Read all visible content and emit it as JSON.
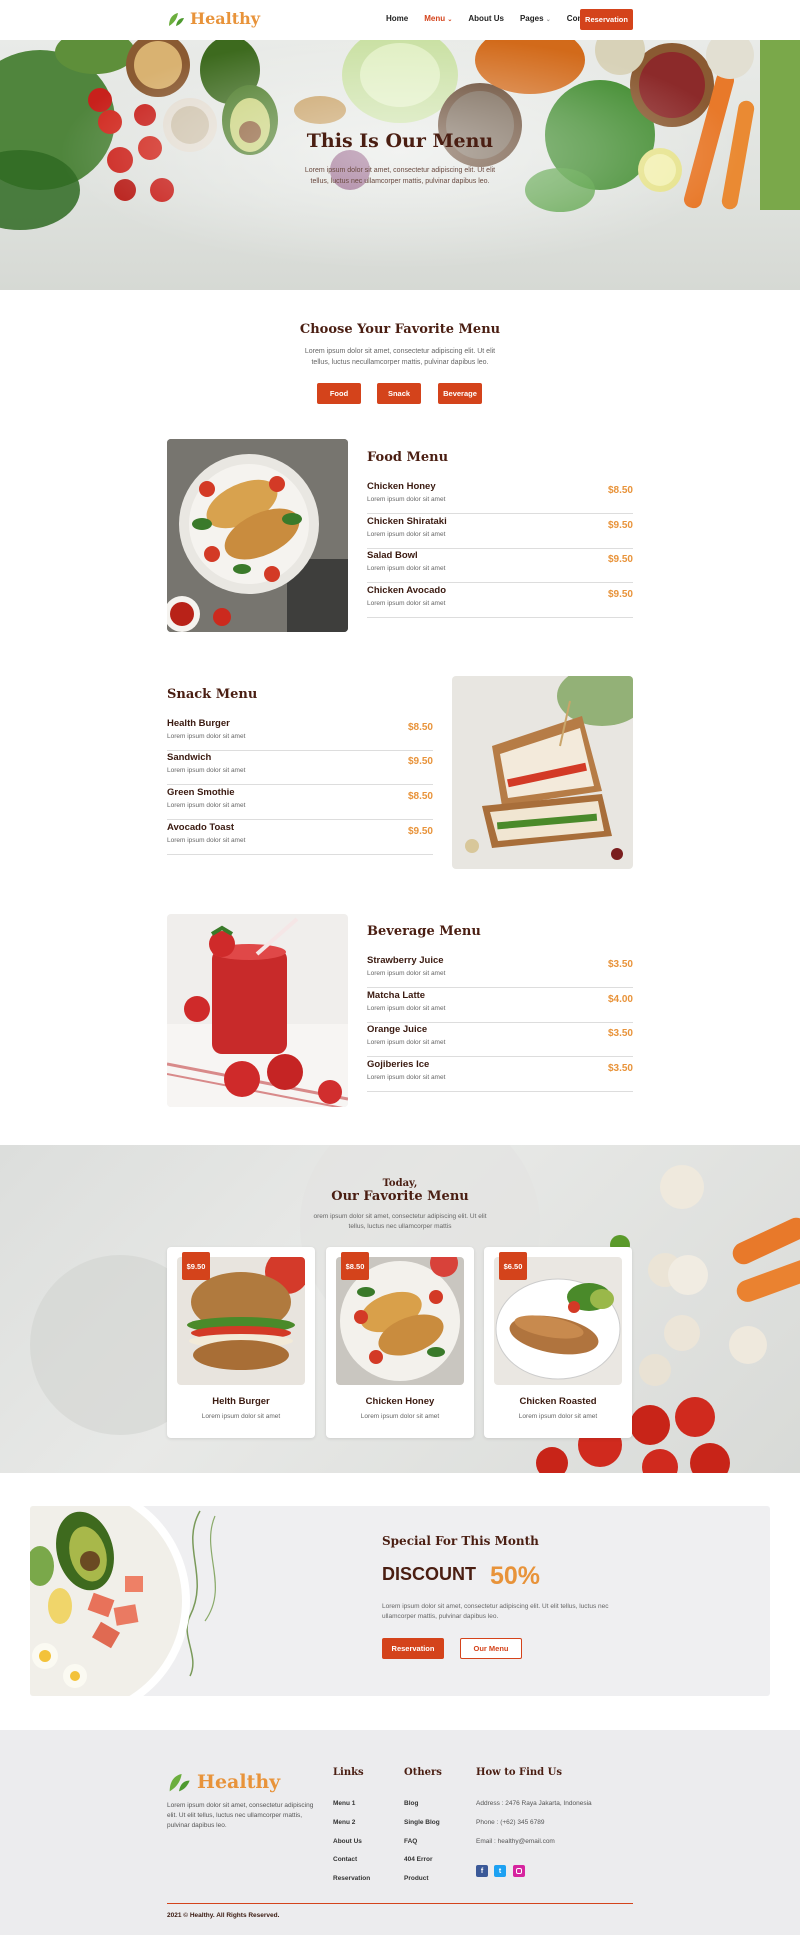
{
  "header": {
    "logo_text": "Healthy",
    "nav": [
      {
        "label": "Home"
      },
      {
        "label": "Menu"
      },
      {
        "label": "About Us"
      },
      {
        "label": "Pages"
      },
      {
        "label": "Contact Us"
      }
    ],
    "reservation_label": "Reservation"
  },
  "hero": {
    "title": "This Is Our Menu",
    "subtitle": "Lorem ipsum dolor sit amet, consectetur adipiscing elit. Ut elit tellus, luctus nec ullamcorper mattis, pulvinar dapibus leo."
  },
  "choose": {
    "title": "Choose Your Favorite Menu",
    "desc": "Lorem ipsum dolor sit amet, consectetur adipiscing elit. Ut elit tellus, luctus necullamcorper mattis, pulvinar dapibus leo.",
    "tabs": [
      "Food",
      "Snack",
      "Beverage"
    ]
  },
  "food_menu": {
    "title": "Food Menu",
    "items": [
      {
        "name": "Chicken Honey",
        "desc": "Lorem ipsum dolor sit amet",
        "price": "$8.50"
      },
      {
        "name": "Chicken Shirataki",
        "desc": "Lorem ipsum dolor sit amet",
        "price": "$9.50"
      },
      {
        "name": "Salad Bowl",
        "desc": "Lorem ipsum dolor sit amet",
        "price": "$9.50"
      },
      {
        "name": "Chicken Avocado",
        "desc": "Lorem ipsum dolor sit amet",
        "price": "$9.50"
      }
    ]
  },
  "snack_menu": {
    "title": "Snack Menu",
    "items": [
      {
        "name": "Health Burger",
        "desc": "Lorem ipsum dolor sit amet",
        "price": "$8.50"
      },
      {
        "name": "Sandwich",
        "desc": "Lorem ipsum dolor sit amet",
        "price": "$9.50"
      },
      {
        "name": "Green Smothie",
        "desc": "Lorem ipsum dolor sit amet",
        "price": "$8.50"
      },
      {
        "name": "Avocado Toast",
        "desc": "Lorem ipsum dolor sit amet",
        "price": "$9.50"
      }
    ]
  },
  "beverage_menu": {
    "title": "Beverage Menu",
    "items": [
      {
        "name": "Strawberry Juice",
        "desc": "Lorem ipsum dolor sit amet",
        "price": "$3.50"
      },
      {
        "name": "Matcha Latte",
        "desc": "Lorem ipsum dolor sit amet",
        "price": "$4.00"
      },
      {
        "name": "Orange Juice",
        "desc": "Lorem ipsum dolor sit amet",
        "price": "$3.50"
      },
      {
        "name": "Gojiberies Ice",
        "desc": "Lorem ipsum dolor sit amet",
        "price": "$3.50"
      }
    ]
  },
  "favorites": {
    "kicker": "Today,",
    "title": "Our Favorite Menu",
    "desc": "orem ipsum dolor sit amet, consectetur adipiscing elit. Ut elit tellus, luctus nec ullamcorper mattis",
    "cards": [
      {
        "price": "$9.50",
        "name": "Helth Burger",
        "desc": "Lorem ipsum dolor sit amet"
      },
      {
        "price": "$8.50",
        "name": "Chicken Honey",
        "desc": "Lorem ipsum dolor sit amet"
      },
      {
        "price": "$6.50",
        "name": "Chicken Roasted",
        "desc": "Lorem ipsum dolor sit amet"
      }
    ]
  },
  "special": {
    "title": "Special For This Month",
    "discount_label": "DISCOUNT",
    "discount_value": "50%",
    "desc": "Lorem ipsum dolor sit amet, consectetur adipiscing elit. Ut elit tellus, luctus nec ullamcorper mattis, pulvinar dapibus leo.",
    "reservation_label": "Reservation",
    "menu_label": "Our Menu"
  },
  "footer": {
    "logo_text": "Healthy",
    "about": "Lorem ipsum dolor sit amet, consectetur adipiscing elit. Ut elit tellus, luctus nec ullamcorper mattis, pulvinar dapibus leo.",
    "links_title": "Links",
    "links": [
      "Menu 1",
      "Menu 2",
      "About Us",
      "Contact",
      "Reservation"
    ],
    "others_title": "Others",
    "others": [
      "Blog",
      "Single Blog",
      "FAQ",
      "404 Error",
      "Product"
    ],
    "find_title": "How to Find Us",
    "address": "Address : 2476 Raya Jakarta, Indonesia",
    "phone": "Phone : (+62) 345 6789",
    "email": "Email : healthy@email.com",
    "copyright": "2021 © Healthy. All Rights Reserved."
  },
  "colors": {
    "accent": "#d4431b",
    "price": "#e8933a",
    "heading": "#4a1e12"
  }
}
